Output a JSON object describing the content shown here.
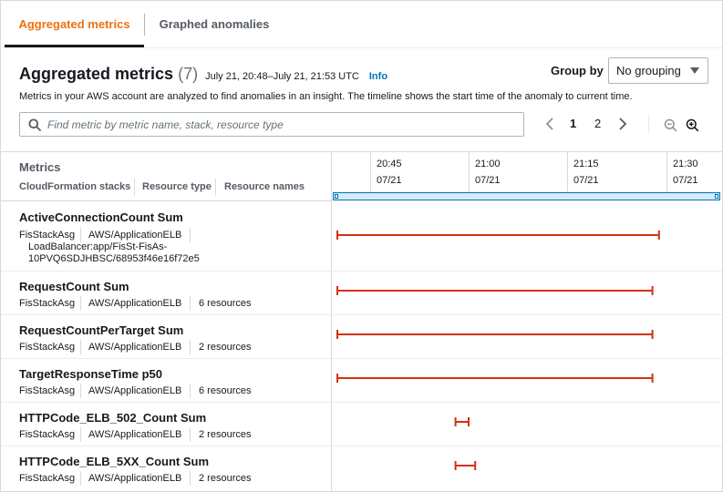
{
  "tabs": [
    {
      "label": "Aggregated metrics",
      "active": true
    },
    {
      "label": "Graphed anomalies",
      "active": false
    }
  ],
  "header": {
    "title": "Aggregated metrics",
    "count": "(7)",
    "range": "July 21, 20:48–July 21, 21:53 UTC",
    "info": "Info",
    "description": "Metrics in your AWS account are analyzed to find anomalies in an insight. The timeline shows the start time of the anomaly to current time."
  },
  "group_by": {
    "label": "Group by",
    "value": "No grouping"
  },
  "search": {
    "placeholder": "Find metric by metric name, stack, resource type",
    "value": ""
  },
  "pagination": {
    "pages": [
      "1",
      "2"
    ],
    "current": "1"
  },
  "table": {
    "metrics_header": "Metrics",
    "sub_headers": [
      "CloudFormation stacks",
      "Resource type",
      "Resource names"
    ]
  },
  "timeline": {
    "ticks": [
      {
        "time": "20:45",
        "date": "07/21"
      },
      {
        "time": "21:00",
        "date": "07/21"
      },
      {
        "time": "21:15",
        "date": "07/21"
      },
      {
        "time": "21:30",
        "date": "07/21"
      }
    ]
  },
  "rows": [
    {
      "name": "ActiveConnectionCount Sum",
      "stack": "FisStackAsg",
      "type": "AWS/ApplicationELB",
      "resources": "LoadBalancer:app/FisSt-FisAs-10PVQ6SDJHBSC/68953f46e16f72e5",
      "start": "20:40",
      "end": "21:29"
    },
    {
      "name": "RequestCount Sum",
      "stack": "FisStackAsg",
      "type": "AWS/ApplicationELB",
      "resources": "6 resources",
      "start": "20:40",
      "end": "21:28"
    },
    {
      "name": "RequestCountPerTarget Sum",
      "stack": "FisStackAsg",
      "type": "AWS/ApplicationELB",
      "resources": "2 resources",
      "start": "20:40",
      "end": "21:28"
    },
    {
      "name": "TargetResponseTime p50",
      "stack": "FisStackAsg",
      "type": "AWS/ApplicationELB",
      "resources": "6 resources",
      "start": "20:40",
      "end": "21:28"
    },
    {
      "name": "HTTPCode_ELB_502_Count Sum",
      "stack": "FisStackAsg",
      "type": "AWS/ApplicationELB",
      "resources": "2 resources",
      "start": "20:58",
      "end": "21:00"
    },
    {
      "name": "HTTPCode_ELB_5XX_Count Sum",
      "stack": "FisStackAsg",
      "type": "AWS/ApplicationELB",
      "resources": "2 resources",
      "start": "20:58",
      "end": "21:01"
    }
  ],
  "colors": {
    "accent": "#ec7211",
    "link": "#0073bb",
    "anomaly": "#d13212"
  }
}
